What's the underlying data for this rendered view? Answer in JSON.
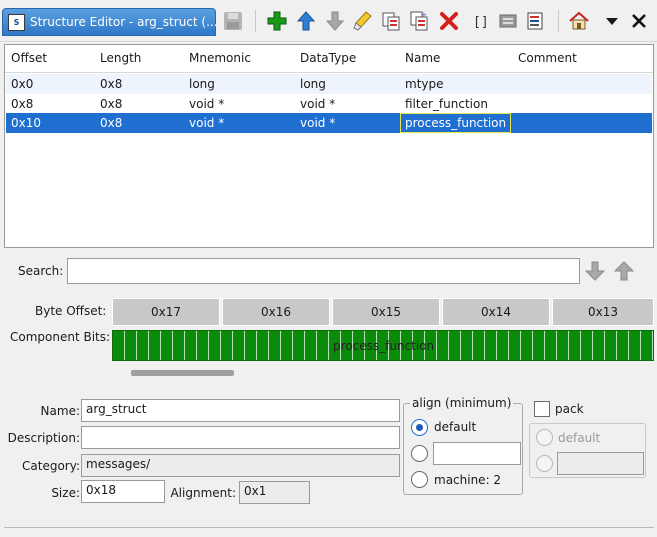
{
  "window": {
    "title": "Structure Editor - arg_struct (...",
    "icon_label": "S"
  },
  "toolbar": {
    "icons": [
      "save-icon",
      "add-icon",
      "move-up-icon",
      "move-down-icon",
      "clear-icon",
      "duplicate-icon",
      "duplicate-multiple-icon",
      "delete-icon",
      "array-icon",
      "create-structure-icon",
      "unpackage-icon",
      "home-icon",
      "menu-dropdown-icon",
      "close-icon"
    ],
    "array_glyph": "[]"
  },
  "table": {
    "headers": [
      "Offset",
      "Length",
      "Mnemonic",
      "DataType",
      "Name",
      "Comment"
    ],
    "rows": [
      {
        "offset": "0x0",
        "length": "0x8",
        "mnemonic": "long",
        "datatype": "long",
        "name": "mtype",
        "comment": ""
      },
      {
        "offset": "0x8",
        "length": "0x8",
        "mnemonic": "void *",
        "datatype": "void *",
        "name": "filter_function",
        "comment": ""
      },
      {
        "offset": "0x10",
        "length": "0x8",
        "mnemonic": "void *",
        "datatype": "void *",
        "name": "process_function",
        "comment": ""
      }
    ],
    "selected_row": 2
  },
  "search": {
    "label": "Search:",
    "value": ""
  },
  "bits": {
    "byte_offset_label": "Byte Offset:",
    "byte_offsets": [
      "0x17",
      "0x16",
      "0x15",
      "0x14",
      "0x13"
    ],
    "component_bits_label": "Component Bits:",
    "component_name": "process_function"
  },
  "form": {
    "name_label": "Name:",
    "name_value": "arg_struct",
    "description_label": "Description:",
    "description_value": "",
    "category_label": "Category:",
    "category_value": "messages/",
    "size_label": "Size:",
    "size_value": "0x18",
    "alignment_label": "Alignment:",
    "alignment_value": "0x1"
  },
  "align": {
    "title": "align (minimum)",
    "default_label": "default",
    "explicit_value": "",
    "machine_label": "machine: 2",
    "selected": "default"
  },
  "pack": {
    "label": "pack",
    "checked": false,
    "default_label": "default",
    "explicit_value": ""
  },
  "colors": {
    "selection": "#1e6fd0",
    "bits_green": "#0a8c0a",
    "title_tab": "#3a86d4"
  }
}
